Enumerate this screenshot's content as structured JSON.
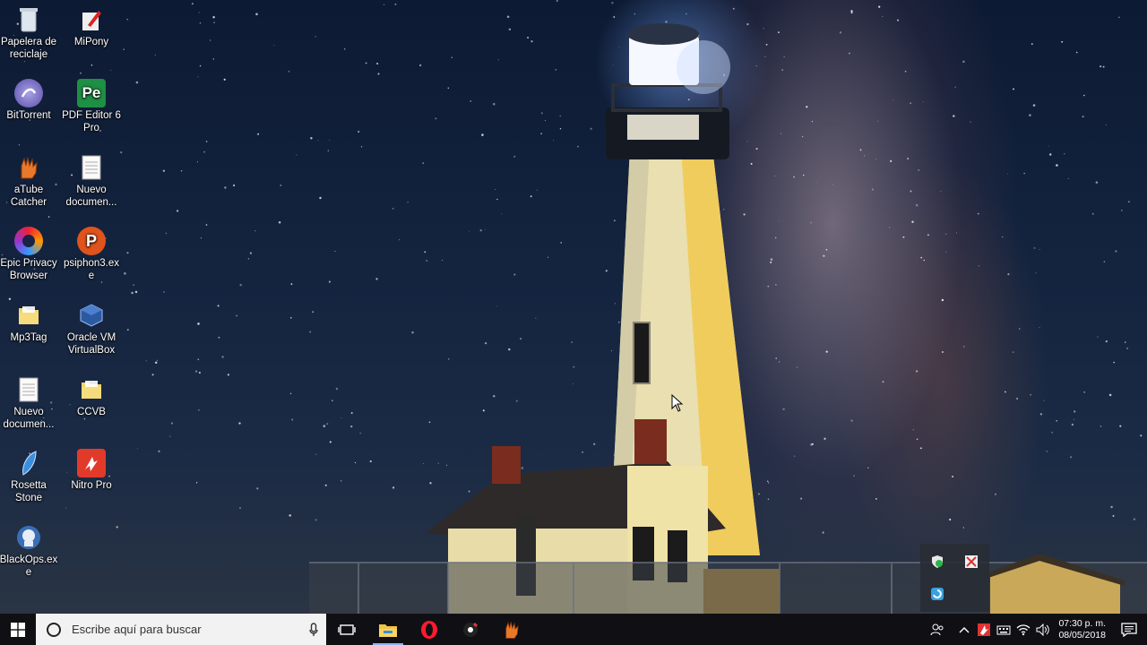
{
  "desktop": {
    "icons": [
      {
        "label": "Papelera de reciclaje",
        "icon": "recycle-bin-icon"
      },
      {
        "label": "MiPony",
        "icon": "mipony-icon"
      },
      {
        "label": "BitTorrent",
        "icon": "bittorrent-icon"
      },
      {
        "label": "PDF Editor 6 Pro",
        "icon": "pdf-editor-icon"
      },
      {
        "label": "aTube Catcher",
        "icon": "atube-catcher-icon"
      },
      {
        "label": "Nuevo documen...",
        "icon": "text-document-icon"
      },
      {
        "label": "Epic Privacy Browser",
        "icon": "epic-browser-icon"
      },
      {
        "label": "psiphon3.exe",
        "icon": "psiphon-icon"
      },
      {
        "label": "Mp3Tag",
        "icon": "folder-icon"
      },
      {
        "label": "Oracle VM VirtualBox",
        "icon": "virtualbox-icon"
      },
      {
        "label": "Nuevo documen...",
        "icon": "text-document-icon"
      },
      {
        "label": "CCVB",
        "icon": "folder-icon"
      },
      {
        "label": "Rosetta Stone",
        "icon": "rosetta-stone-icon"
      },
      {
        "label": "Nitro Pro",
        "icon": "nitro-pro-icon"
      },
      {
        "label": "BlackOps.exe",
        "icon": "blackops-icon"
      }
    ]
  },
  "taskbar": {
    "search_placeholder": "Escribe aquí para buscar",
    "pinned": [
      {
        "name": "task-view",
        "icon": "task-view-icon"
      },
      {
        "name": "file-explorer",
        "icon": "file-explorer-icon",
        "active": true
      },
      {
        "name": "opera",
        "icon": "opera-icon"
      },
      {
        "name": "media-app",
        "icon": "media-app-icon"
      },
      {
        "name": "atube-catcher",
        "icon": "atube-catcher-icon"
      }
    ],
    "clock": {
      "time": "07:30 p. m.",
      "date": "08/05/2018"
    }
  },
  "colors": {
    "taskbar_bg": "#101014",
    "search_bg": "#f2f2f2",
    "accent": "#8ab4ff"
  }
}
